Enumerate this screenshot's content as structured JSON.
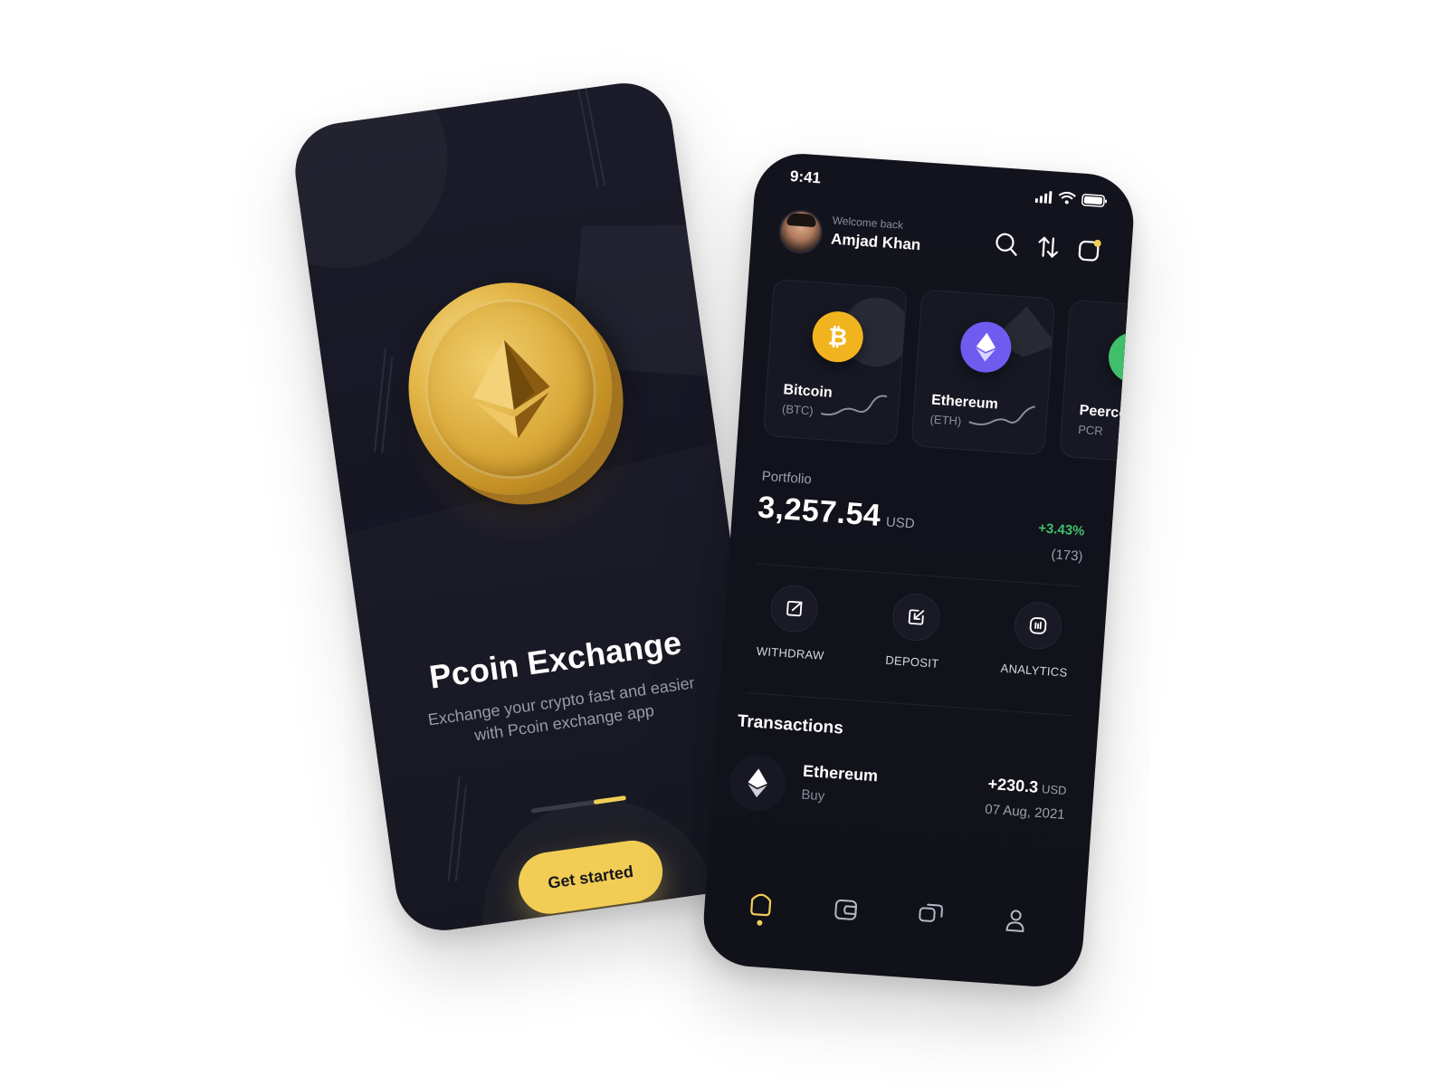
{
  "onboarding": {
    "title": "Pcoin Exchange",
    "subtitle": "Exchange your crypto fast and easier with Pcoin exchange app",
    "cta_label": "Get started",
    "progress": 0.34,
    "accent_color": "#f1cd55"
  },
  "home": {
    "status": {
      "time": "9:41"
    },
    "header": {
      "welcome": "Welcome back",
      "user_name": "Amjad Khan",
      "icons": [
        "search-icon",
        "swap-icon",
        "notification-icon"
      ]
    },
    "coins": [
      {
        "name": "Bitcoin",
        "ticker": "(BTC)",
        "symbol": "₿",
        "color": "#f2b41e"
      },
      {
        "name": "Ethereum",
        "ticker": "(ETH)",
        "symbol": "eth-icon",
        "color": "#6f5bf0"
      },
      {
        "name": "Peercoin",
        "ticker": "PCR",
        "symbol": "peercoin-icon",
        "color": "#3fbf6a"
      }
    ],
    "portfolio": {
      "label": "Portfolio",
      "value": "3,257.54",
      "unit": "USD",
      "change": "+3.43%",
      "count": "(173)",
      "change_color": "#3fbf6a"
    },
    "actions": [
      {
        "label": "WITHDRAW",
        "icon": "withdraw-icon"
      },
      {
        "label": "DEPOSIT",
        "icon": "deposit-icon"
      },
      {
        "label": "ANALYTICS",
        "icon": "analytics-icon"
      }
    ],
    "transactions": {
      "title": "Transactions",
      "items": [
        {
          "name": "Ethereum",
          "type": "Buy",
          "amount": "+230.3",
          "unit": "USD",
          "date": "07 Aug, 2021"
        }
      ]
    },
    "nav": [
      "home-icon",
      "wallet-icon",
      "chat-icon",
      "profile-icon"
    ]
  }
}
